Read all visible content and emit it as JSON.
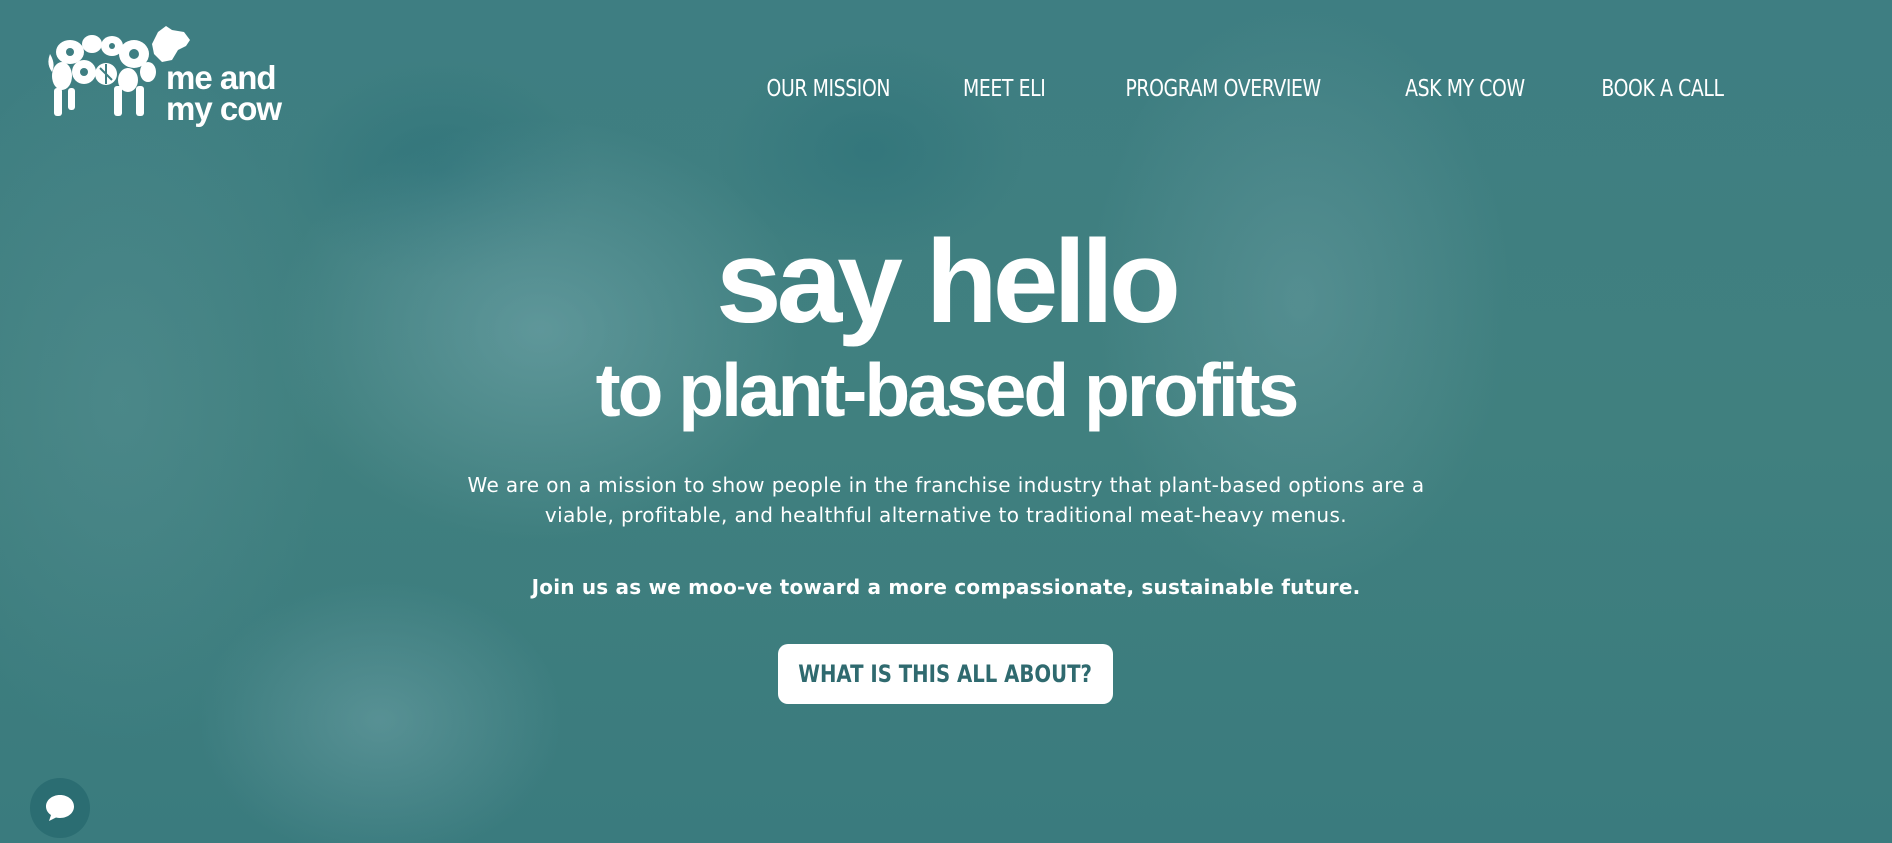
{
  "brand": {
    "logo_line1": "me and",
    "logo_line2": "my cow",
    "logo_icon": "cow-with-vegetables-icon"
  },
  "nav": {
    "items": [
      {
        "label": "OUR MISSION"
      },
      {
        "label": "MEET ELI"
      },
      {
        "label": "PROGRAM OVERVIEW"
      },
      {
        "label": "ASK MY COW"
      },
      {
        "label": "BOOK A CALL"
      }
    ]
  },
  "hero": {
    "headline": "say hello",
    "subheadline": "to plant-based profits",
    "description_line1": "We are on a mission to show people in the franchise industry that plant-based options are a",
    "description_line2": "viable, profitable, and healthful alternative to traditional meat-heavy menus.",
    "tagline": "Join us as we moo-ve toward a more compassionate, sustainable future.",
    "cta_label": "WHAT IS THIS ALL ABOUT?"
  },
  "chat": {
    "icon": "chat-bubble-icon"
  },
  "colors": {
    "overlay": "#3e7e82",
    "text": "#ffffff",
    "cta_text": "#2f6a6f",
    "chat_bg": "#2b6d72"
  }
}
